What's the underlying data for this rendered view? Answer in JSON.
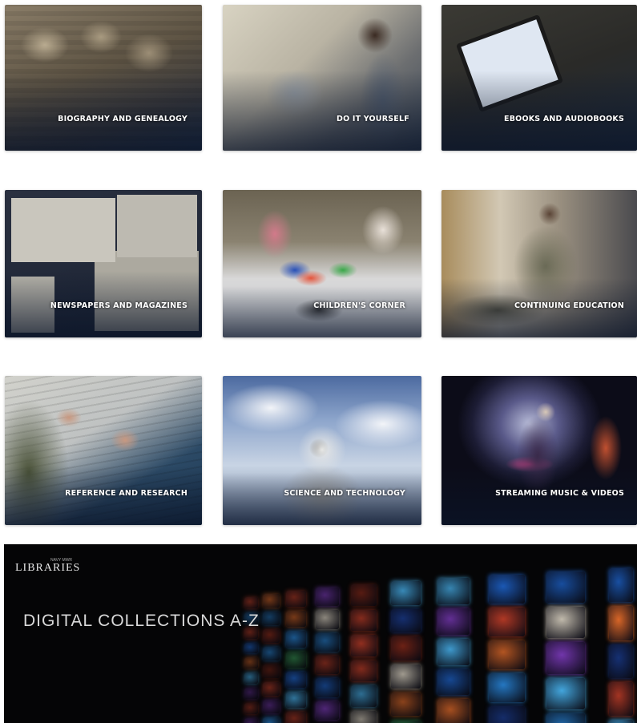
{
  "tiles": [
    {
      "label": "BIOGRAPHY AND GENEALOGY",
      "icon": "sepia-crowd-photo"
    },
    {
      "label": "DO IT YOURSELF",
      "icon": "woman-with-machine-photo"
    },
    {
      "label": "EBOOKS AND AUDIOBOOKS",
      "icon": "ereader-photo"
    },
    {
      "label": "NEWSPAPERS AND MAGAZINES",
      "icon": "newspapers-photo"
    },
    {
      "label": "CHILDREN'S CORNER",
      "icon": "children-craft-table-photo"
    },
    {
      "label": "CONTINUING EDUCATION",
      "icon": "soldier-reading-photo"
    },
    {
      "label": "REFERENCE AND RESEARCH",
      "icon": "writing-notebook-photo"
    },
    {
      "label": "SCIENCE AND TECHNOLOGY",
      "icon": "astronaut-photo"
    },
    {
      "label": "STREAMING MUSIC & VIDEOS",
      "icon": "guitarist-photo"
    }
  ],
  "banner": {
    "title": "DIGITAL COLLECTIONS A-Z",
    "logo": "LIBRARIES",
    "logo_small": "NAVY MWR",
    "icon": "screens-wall-image"
  }
}
